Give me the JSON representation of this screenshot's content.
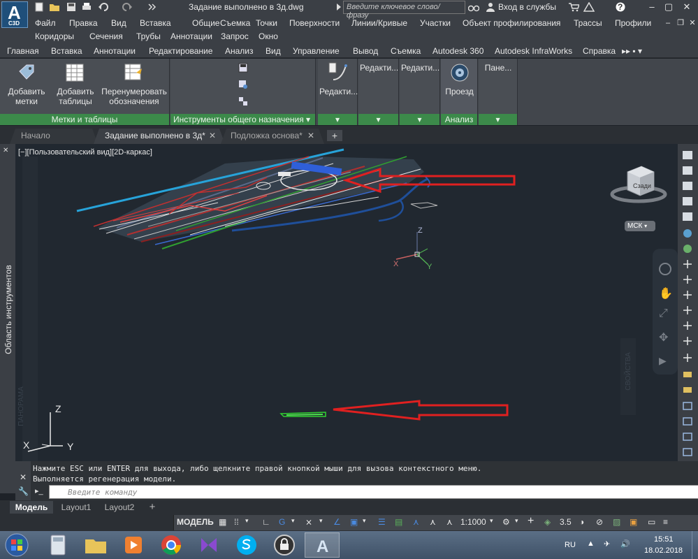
{
  "app": {
    "logo_letter": "A",
    "logo_sub": "C3D",
    "document_title": "Задание выполнено в 3д.dwg",
    "search_placeholder": "Введите ключевое слово/фразу",
    "sign_in": "Вход в службы",
    "help": "?"
  },
  "menu_row1": [
    "Файл",
    "Правка",
    "Вид",
    "Вставка",
    "Общие",
    "Съемка",
    "Точки",
    "Поверхности",
    "Линии/Кривые",
    "Участки",
    "Объект профилирования",
    "Трассы",
    "Профили"
  ],
  "menu_row2": [
    "Коридоры",
    "Сечения",
    "Трубы",
    "Аннотации",
    "Запрос",
    "Окно"
  ],
  "ribbon_tabs": [
    "Главная",
    "Вставка",
    "Аннотации",
    "Редактирование",
    "Анализ",
    "Вид",
    "Управление",
    "Вывод",
    "Съемка",
    "Autodesk 360",
    "Autodesk InfraWorks",
    "Справка"
  ],
  "ribbon": {
    "add_labels": [
      "Добавить",
      "метки"
    ],
    "add_tables": [
      "Добавить",
      "таблицы"
    ],
    "renumber": [
      "Перенумеровать",
      "обозначения"
    ],
    "panel_labels_tables": "Метки и таблицы",
    "panel_general_tools": "Инструменты общего назначения",
    "edit_1": "Редакти...",
    "edit_2": "Редакти...",
    "edit_3": "Редакти...",
    "drive": "Проезд",
    "panel_analysis": "Анализ",
    "panels": "Пане..."
  },
  "doc_tabs": [
    {
      "label": "Начало",
      "active": false
    },
    {
      "label": "Задание выполнено в 3д*",
      "active": true
    },
    {
      "label": "Подложка основа*",
      "active": false
    }
  ],
  "tool_palette_label": "Область инструментов",
  "viewport": {
    "view_label": "[−][Пользовательский вид][2D-каркас]",
    "viewcube_face": "Сзади",
    "ucs_name": "МСК",
    "axis_z": "Z",
    "axis_x": "X",
    "axis_y": "Y",
    "palette_shadow_1": "ПАНОРАМА",
    "palette_shadow_2": "СВОЙСТВА"
  },
  "command": {
    "history": [
      "Нажмите ESC или ENTER для выхода, либо щелкните правой кнопкой мыши для вызова контекстного меню.",
      "Выполняется регенерация модели."
    ],
    "placeholder": "Введите команду"
  },
  "layout_tabs": [
    {
      "label": "Модель",
      "active": true
    },
    {
      "label": "Layout1",
      "active": false
    },
    {
      "label": "Layout2",
      "active": false
    }
  ],
  "status": {
    "model_label": "МОДЕЛЬ",
    "scale": "1:1000",
    "lineweight": "3.5"
  },
  "taskbar": {
    "lang": "RU",
    "time": "15:51",
    "date": "18.02.2018"
  },
  "colors": {
    "annotation_arrow": "#e02020",
    "ribbon_panel_footer": "#3c8a4a",
    "viewport_bg": "#212830"
  }
}
